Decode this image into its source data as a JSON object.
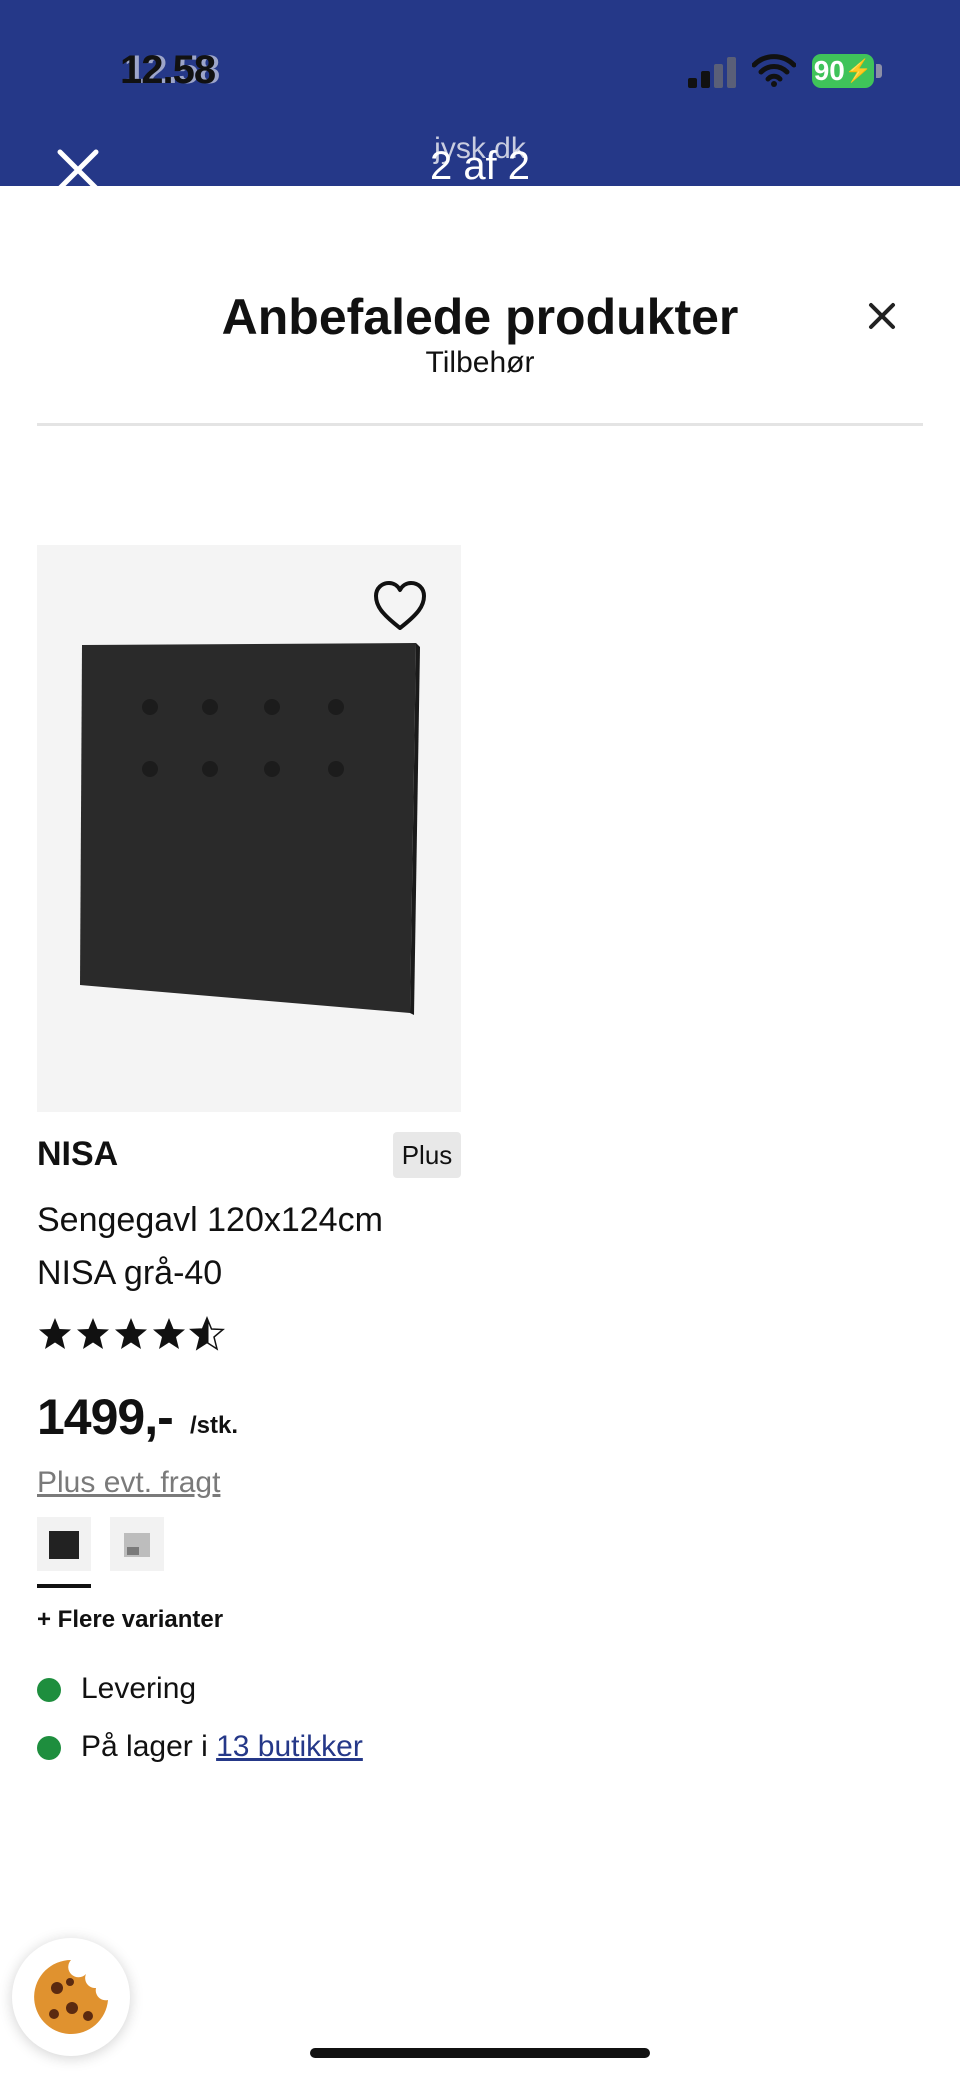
{
  "status_bar": {
    "time": "12.58",
    "battery": "90"
  },
  "top_bar": {
    "domain": "jysk.dk",
    "pager": "2 af 2"
  },
  "sheet": {
    "title": "Anbefalede produkter",
    "subtitle": "Tilbehør"
  },
  "product": {
    "brand": "NISA",
    "badge": "Plus",
    "description_line1": "Sengegavl 120x124cm",
    "description_line2": "NISA grå-40",
    "rating": 4.5,
    "rating_max": 5,
    "price": "1499,-",
    "unit": "/stk.",
    "freight": "Plus evt. fragt",
    "more_variants": "+ Flere varianter",
    "delivery": "Levering",
    "stock_prefix": "På lager i",
    "stock_link": "13 butikker"
  },
  "colors": {
    "brand_blue": "#253888",
    "in_stock_green": "#1e8e3e",
    "battery_green": "#3fc35a"
  },
  "icons": [
    "close-icon",
    "signal-icon",
    "wifi-icon",
    "battery-icon",
    "heart-icon",
    "star-icon",
    "cookie-icon"
  ]
}
